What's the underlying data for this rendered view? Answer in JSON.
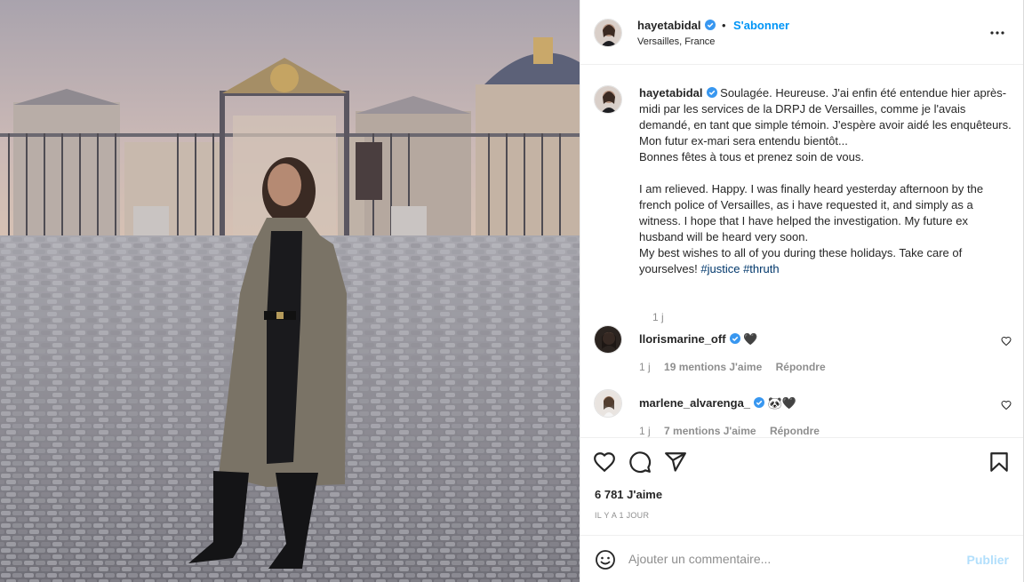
{
  "post": {
    "author": "hayetabidal",
    "location": "Versailles, France",
    "follow_label": "S'abonner",
    "separator": "•",
    "caption_fr": "Soulagée. Heureuse. J'ai enfin été entendue hier après-midi par les services de la DRPJ de Versailles, comme je l'avais demandé, en tant que simple témoin. J'espère avoir aidé les enquêteurs. Mon futur ex-mari sera entendu bientôt...\nBonnes fêtes à tous et prenez soin de vous.",
    "caption_en": "I am relieved. Happy. I was finally heard yesterday afternoon by the french police of Versailles, as i have requested it, and simply as a witness. I hope that I have helped the investigation. My future ex husband will be heard very soon.\nMy best wishes to all of you during these holidays. Take care of yourselves! ",
    "hashtags": [
      "#justice",
      "#thruth"
    ],
    "caption_time": "1 j",
    "likes": "6 781 J'aime",
    "time_ago": "IL Y A 1 JOUR"
  },
  "comments": [
    {
      "username": "llorismarine_off",
      "text": "🖤",
      "time": "1 j",
      "likes": "19 mentions J'aime",
      "reply": "Répondre"
    },
    {
      "username": "marlene_alvarenga_",
      "text": "🐼🖤",
      "time": "1 j",
      "likes": "7 mentions J'aime",
      "reply": "Répondre"
    }
  ],
  "add_comment": {
    "placeholder": "Ajouter un commentaire...",
    "publish_label": "Publier"
  },
  "icons": {
    "more": "more-options-icon",
    "like": "heart-icon",
    "comment": "comment-icon",
    "share": "share-icon",
    "save": "bookmark-icon",
    "emoji": "emoji-icon",
    "verified": "verified-badge-icon"
  },
  "colors": {
    "accent": "#0095f6",
    "hashtag": "#00376b",
    "muted": "#8e8e8e",
    "publish_disabled": "#b2dffc"
  }
}
